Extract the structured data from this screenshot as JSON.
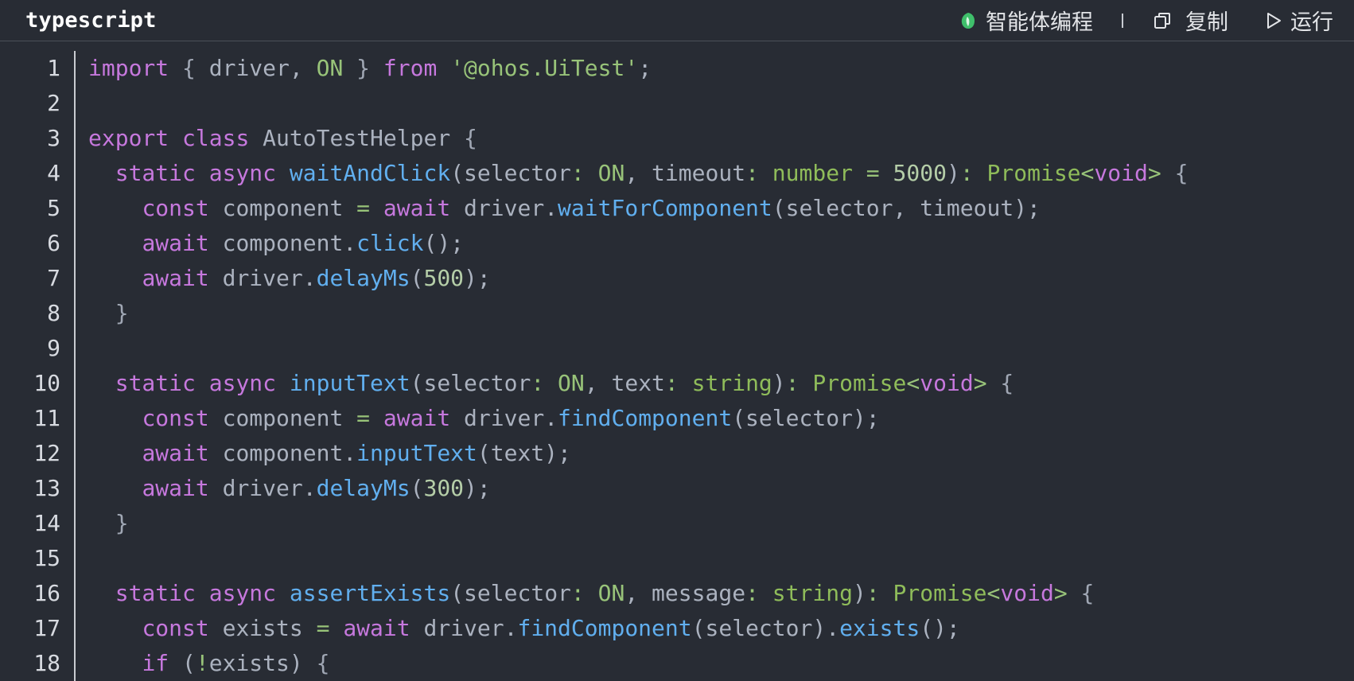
{
  "header": {
    "language": "typescript",
    "ai_label": "智能体编程",
    "copy_label": "复制",
    "run_label": "运行"
  },
  "colors": {
    "background": "#282c34",
    "keyword": "#c678dd",
    "function": "#61afef",
    "string": "#98c379",
    "number": "#b5cea8",
    "identifier": "#abb2bf",
    "ai_icon_green": "#3fbf6b"
  },
  "icons": {
    "ai": "leaf-logo-icon",
    "copy": "copy-icon",
    "run": "play-icon"
  },
  "code_lines": [
    {
      "n": "1",
      "tokens": [
        [
          "kw",
          "import"
        ],
        [
          "id",
          " "
        ],
        [
          "punc",
          "{"
        ],
        [
          "id",
          " driver, "
        ],
        [
          "type",
          "ON"
        ],
        [
          "id",
          " "
        ],
        [
          "punc",
          "}"
        ],
        [
          "id",
          " "
        ],
        [
          "kw",
          "from"
        ],
        [
          "id",
          " "
        ],
        [
          "str",
          "'@ohos.UiTest'"
        ],
        [
          "id",
          ";"
        ]
      ]
    },
    {
      "n": "2",
      "tokens": []
    },
    {
      "n": "3",
      "tokens": [
        [
          "kw",
          "export"
        ],
        [
          "id",
          " "
        ],
        [
          "kw",
          "class"
        ],
        [
          "id",
          " AutoTestHelper "
        ],
        [
          "punc",
          "{"
        ]
      ]
    },
    {
      "n": "4",
      "tokens": [
        [
          "id",
          "  "
        ],
        [
          "kw",
          "static"
        ],
        [
          "id",
          " "
        ],
        [
          "kw",
          "async"
        ],
        [
          "id",
          " "
        ],
        [
          "fn",
          "waitAndClick"
        ],
        [
          "id",
          "(selector"
        ],
        [
          "op",
          ":"
        ],
        [
          "id",
          " "
        ],
        [
          "type",
          "ON"
        ],
        [
          "id",
          ", timeout"
        ],
        [
          "op",
          ":"
        ],
        [
          "id",
          " "
        ],
        [
          "ty2",
          "number"
        ],
        [
          "id",
          " "
        ],
        [
          "op",
          "="
        ],
        [
          "id",
          " "
        ],
        [
          "num",
          "5000"
        ],
        [
          "id",
          ")"
        ],
        [
          "op",
          ":"
        ],
        [
          "id",
          " "
        ],
        [
          "ty2",
          "Promise"
        ],
        [
          "op",
          "<"
        ],
        [
          "kw",
          "void"
        ],
        [
          "op",
          ">"
        ],
        [
          "id",
          " "
        ],
        [
          "punc",
          "{"
        ]
      ]
    },
    {
      "n": "5",
      "tokens": [
        [
          "id",
          "    "
        ],
        [
          "kw",
          "const"
        ],
        [
          "id",
          " component "
        ],
        [
          "op",
          "="
        ],
        [
          "id",
          " "
        ],
        [
          "kw",
          "await"
        ],
        [
          "id",
          " driver."
        ],
        [
          "fn",
          "waitForComponent"
        ],
        [
          "id",
          "(selector, timeout);"
        ]
      ]
    },
    {
      "n": "6",
      "tokens": [
        [
          "id",
          "    "
        ],
        [
          "kw",
          "await"
        ],
        [
          "id",
          " component."
        ],
        [
          "fn",
          "click"
        ],
        [
          "id",
          "();"
        ]
      ]
    },
    {
      "n": "7",
      "tokens": [
        [
          "id",
          "    "
        ],
        [
          "kw",
          "await"
        ],
        [
          "id",
          " driver."
        ],
        [
          "fn",
          "delayMs"
        ],
        [
          "id",
          "("
        ],
        [
          "num",
          "500"
        ],
        [
          "id",
          ");"
        ]
      ]
    },
    {
      "n": "8",
      "tokens": [
        [
          "id",
          "  "
        ],
        [
          "punc",
          "}"
        ]
      ]
    },
    {
      "n": "9",
      "tokens": []
    },
    {
      "n": "10",
      "tokens": [
        [
          "id",
          "  "
        ],
        [
          "kw",
          "static"
        ],
        [
          "id",
          " "
        ],
        [
          "kw",
          "async"
        ],
        [
          "id",
          " "
        ],
        [
          "fn",
          "inputText"
        ],
        [
          "id",
          "(selector"
        ],
        [
          "op",
          ":"
        ],
        [
          "id",
          " "
        ],
        [
          "type",
          "ON"
        ],
        [
          "id",
          ", text"
        ],
        [
          "op",
          ":"
        ],
        [
          "id",
          " "
        ],
        [
          "ty2",
          "string"
        ],
        [
          "id",
          ")"
        ],
        [
          "op",
          ":"
        ],
        [
          "id",
          " "
        ],
        [
          "ty2",
          "Promise"
        ],
        [
          "op",
          "<"
        ],
        [
          "kw",
          "void"
        ],
        [
          "op",
          ">"
        ],
        [
          "id",
          " "
        ],
        [
          "punc",
          "{"
        ]
      ]
    },
    {
      "n": "11",
      "tokens": [
        [
          "id",
          "    "
        ],
        [
          "kw",
          "const"
        ],
        [
          "id",
          " component "
        ],
        [
          "op",
          "="
        ],
        [
          "id",
          " "
        ],
        [
          "kw",
          "await"
        ],
        [
          "id",
          " driver."
        ],
        [
          "fn",
          "findComponent"
        ],
        [
          "id",
          "(selector);"
        ]
      ]
    },
    {
      "n": "12",
      "tokens": [
        [
          "id",
          "    "
        ],
        [
          "kw",
          "await"
        ],
        [
          "id",
          " component."
        ],
        [
          "fn",
          "inputText"
        ],
        [
          "id",
          "(text);"
        ]
      ]
    },
    {
      "n": "13",
      "tokens": [
        [
          "id",
          "    "
        ],
        [
          "kw",
          "await"
        ],
        [
          "id",
          " driver."
        ],
        [
          "fn",
          "delayMs"
        ],
        [
          "id",
          "("
        ],
        [
          "num",
          "300"
        ],
        [
          "id",
          ");"
        ]
      ]
    },
    {
      "n": "14",
      "tokens": [
        [
          "id",
          "  "
        ],
        [
          "punc",
          "}"
        ]
      ]
    },
    {
      "n": "15",
      "tokens": []
    },
    {
      "n": "16",
      "tokens": [
        [
          "id",
          "  "
        ],
        [
          "kw",
          "static"
        ],
        [
          "id",
          " "
        ],
        [
          "kw",
          "async"
        ],
        [
          "id",
          " "
        ],
        [
          "fn",
          "assertExists"
        ],
        [
          "id",
          "(selector"
        ],
        [
          "op",
          ":"
        ],
        [
          "id",
          " "
        ],
        [
          "type",
          "ON"
        ],
        [
          "id",
          ", message"
        ],
        [
          "op",
          ":"
        ],
        [
          "id",
          " "
        ],
        [
          "ty2",
          "string"
        ],
        [
          "id",
          ")"
        ],
        [
          "op",
          ":"
        ],
        [
          "id",
          " "
        ],
        [
          "ty2",
          "Promise"
        ],
        [
          "op",
          "<"
        ],
        [
          "kw",
          "void"
        ],
        [
          "op",
          ">"
        ],
        [
          "id",
          " "
        ],
        [
          "punc",
          "{"
        ]
      ]
    },
    {
      "n": "17",
      "tokens": [
        [
          "id",
          "    "
        ],
        [
          "kw",
          "const"
        ],
        [
          "id",
          " exists "
        ],
        [
          "op",
          "="
        ],
        [
          "id",
          " "
        ],
        [
          "kw",
          "await"
        ],
        [
          "id",
          " driver."
        ],
        [
          "fn",
          "findComponent"
        ],
        [
          "id",
          "(selector)."
        ],
        [
          "fn",
          "exists"
        ],
        [
          "id",
          "();"
        ]
      ]
    },
    {
      "n": "18",
      "tokens": [
        [
          "id",
          "    "
        ],
        [
          "kw",
          "if"
        ],
        [
          "id",
          " ("
        ],
        [
          "op",
          "!"
        ],
        [
          "id",
          "exists) "
        ],
        [
          "punc",
          "{"
        ]
      ]
    }
  ]
}
